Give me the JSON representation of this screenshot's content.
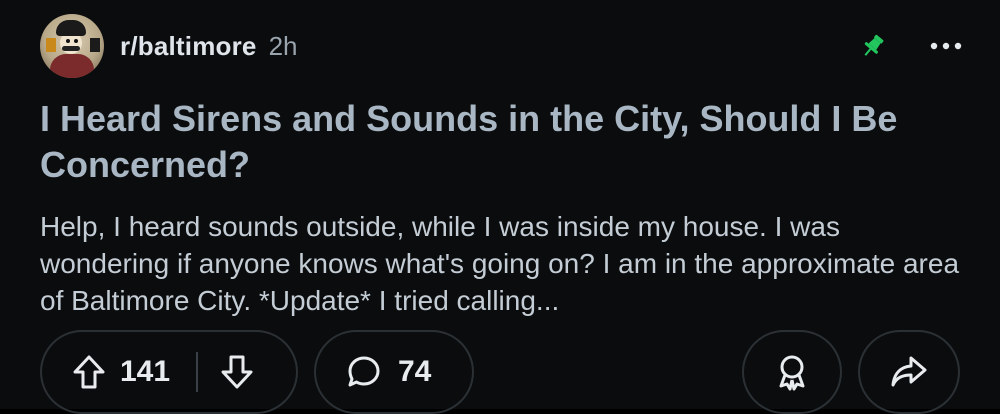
{
  "post": {
    "subreddit": "r/baltimore",
    "time_ago": "2h",
    "title": "I Heard Sirens and Sounds in the City, Should I Be Concerned?",
    "body": "Help, I heard sounds outside, while I was inside my house. I was wondering if anyone knows what's going on? I am in the approximate area of Baltimore City. *Update* I tried calling..."
  },
  "actions": {
    "upvotes": "141",
    "comments": "74"
  },
  "colors": {
    "background": "#0b0c0d",
    "title": "#a9b7c4",
    "pin": "#22c55e"
  },
  "icons": {
    "avatar": "subreddit-avatar",
    "pin": "pin-icon",
    "more": "more-options-icon",
    "upvote": "upvote-arrow-icon",
    "downvote": "downvote-arrow-icon",
    "comment": "comment-bubble-icon",
    "award": "award-icon",
    "share": "share-arrow-icon"
  }
}
